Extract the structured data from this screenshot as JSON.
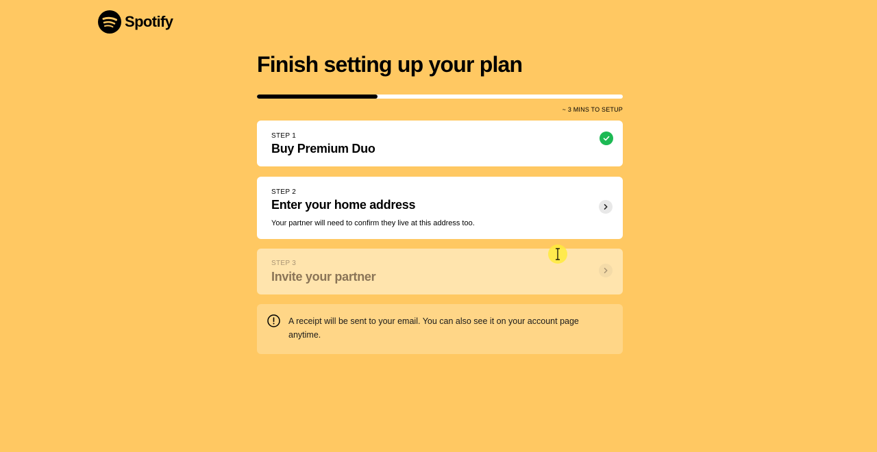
{
  "brand": {
    "name": "Spotify",
    "logo_icon": "spotify-logo-icon"
  },
  "page": {
    "title": "Finish setting up your plan",
    "progress_fraction": 0.33,
    "setup_time": "~ 3 MINS TO SETUP"
  },
  "steps": [
    {
      "label": "STEP 1",
      "title": "Buy Premium Duo",
      "status": "completed",
      "icon": "check-circle-icon"
    },
    {
      "label": "STEP 2",
      "title": "Enter your home address",
      "description": "Your partner will need to confirm they live at this address too.",
      "status": "active",
      "icon": "chevron-right-icon"
    },
    {
      "label": "STEP 3",
      "title": "Invite your partner",
      "status": "locked",
      "icon": "chevron-right-icon"
    }
  ],
  "notice": {
    "icon": "exclamation-circle-icon",
    "text": "A receipt will be sent to your email. You can also see it on your account page anytime."
  },
  "colors": {
    "background": "#FFC862",
    "progress_fill": "#000000",
    "progress_track": "#FFFFFF",
    "success": "#1DB954"
  }
}
